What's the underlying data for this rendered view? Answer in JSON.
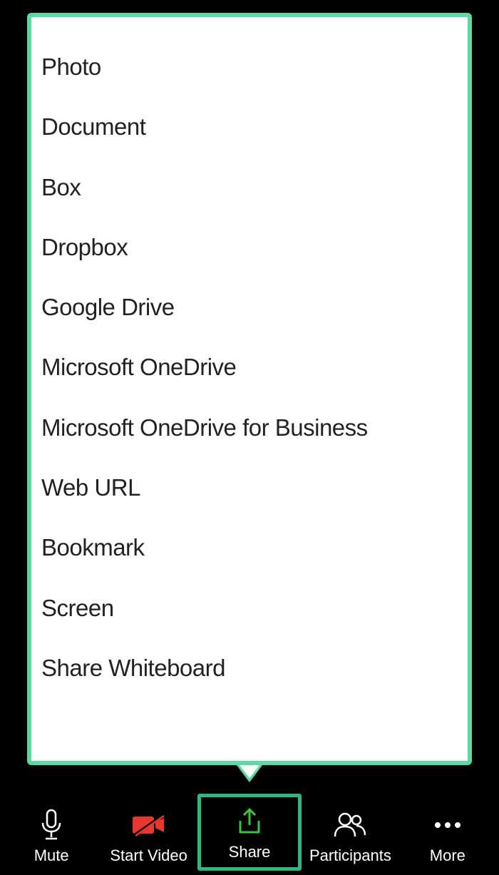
{
  "share_menu": {
    "items": [
      {
        "label": "Photo"
      },
      {
        "label": "Document"
      },
      {
        "label": "Box"
      },
      {
        "label": "Dropbox"
      },
      {
        "label": "Google Drive"
      },
      {
        "label": "Microsoft OneDrive"
      },
      {
        "label": "Microsoft OneDrive for Business"
      },
      {
        "label": "Web URL"
      },
      {
        "label": "Bookmark"
      },
      {
        "label": "Screen"
      },
      {
        "label": "Share Whiteboard"
      }
    ]
  },
  "toolbar": {
    "mute": "Mute",
    "start_video": "Start Video",
    "share": "Share",
    "participants": "Participants",
    "more": "More"
  }
}
